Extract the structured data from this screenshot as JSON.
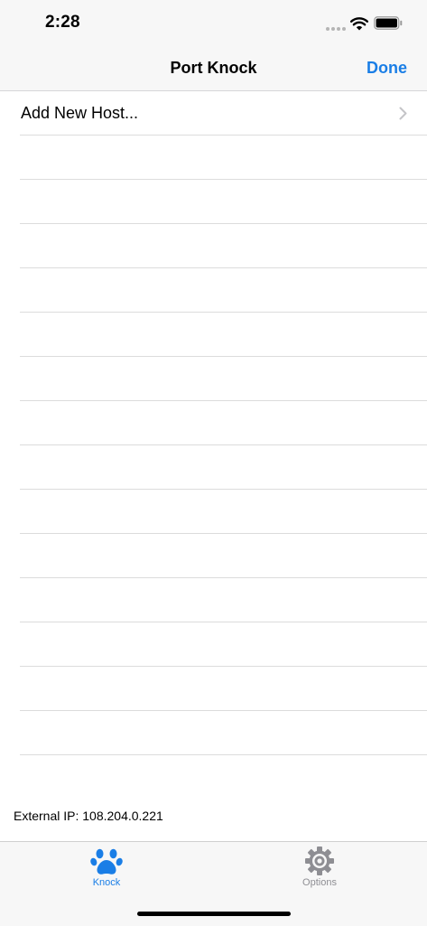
{
  "status_bar": {
    "time": "2:28"
  },
  "nav": {
    "title": "Port Knock",
    "done_label": "Done"
  },
  "table": {
    "add_host_label": "Add New Host...",
    "empty_row_count_note": ""
  },
  "footer": {
    "external_ip": "External IP: 108.204.0.221"
  },
  "tabs": [
    {
      "label": "Knock",
      "icon": "paw-icon",
      "selected": true
    },
    {
      "label": "Options",
      "icon": "gear-icon",
      "selected": false
    }
  ],
  "colors": {
    "accent": "#1a7ee6",
    "inactive": "#8e8e93",
    "bar_background": "#f7f7f7",
    "separator": "#dcdcdc"
  }
}
